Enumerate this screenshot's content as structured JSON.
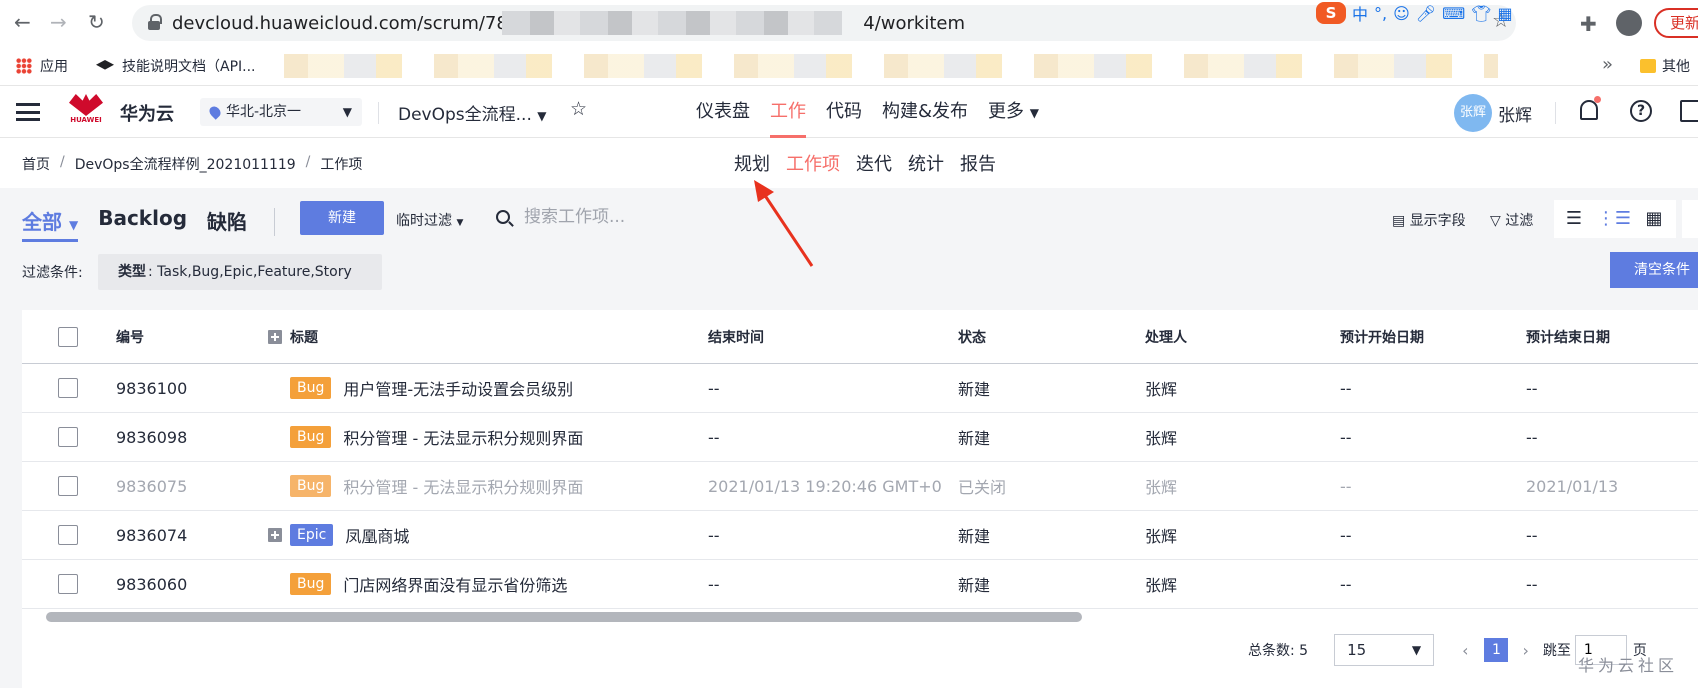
{
  "browser": {
    "url_prefix": "devcloud.huaweicloud.com/scrum/780",
    "url_suffix": "4/workitem",
    "update_label": "更新",
    "bookmarks": [
      {
        "label": "应用"
      },
      {
        "label": "技能说明文档（API..."
      }
    ],
    "other_bookmarks": "其他",
    "ime_label": "中"
  },
  "header": {
    "brand": "华为云",
    "logo_text": "HUAWEI",
    "region": "华北-北京一",
    "project": "DevOps全流程...",
    "nav": [
      {
        "label": "仪表盘",
        "active": false
      },
      {
        "label": "工作",
        "active": true
      },
      {
        "label": "代码",
        "active": false
      },
      {
        "label": "构建&发布",
        "active": false
      },
      {
        "label": "更多",
        "active": false
      }
    ],
    "user_avatar": "张辉",
    "user_name": "张辉"
  },
  "breadcrumb": [
    "首页",
    "DevOps全流程样例_2021011119",
    "工作项"
  ],
  "subnav": [
    {
      "label": "规划",
      "active": false
    },
    {
      "label": "工作项",
      "active": true
    },
    {
      "label": "迭代",
      "active": false
    },
    {
      "label": "统计",
      "active": false
    },
    {
      "label": "报告",
      "active": false
    }
  ],
  "toolbar": {
    "tabs": [
      "全部",
      "Backlog",
      "缺陷"
    ],
    "new_label": "新建",
    "temp_filter": "临时过滤",
    "search_placeholder": "搜索工作项...",
    "fields_label": "显示字段",
    "filter_label": "过滤",
    "filter_condition_label": "过滤条件:",
    "filter_chip_key": "类型",
    "filter_chip_value": ": Task,Bug,Epic,Feature,Story",
    "clear_label": "清空条件"
  },
  "table": {
    "columns": [
      "编号",
      "标题",
      "结束时间",
      "状态",
      "处理人",
      "预计开始日期",
      "预计结束日期"
    ],
    "rows": [
      {
        "id": "9836100",
        "type": "Bug",
        "title": "用户管理-无法手动设置会员级别",
        "end": "--",
        "status": "新建",
        "owner": "张辉",
        "plan_start": "--",
        "plan_end": "--",
        "closed": false,
        "expandable": false
      },
      {
        "id": "9836098",
        "type": "Bug",
        "title": "积分管理 - 无法显示积分规则界面",
        "end": "--",
        "status": "新建",
        "owner": "张辉",
        "plan_start": "--",
        "plan_end": "--",
        "closed": false,
        "expandable": false
      },
      {
        "id": "9836075",
        "type": "Bug",
        "title": "积分管理 - 无法显示积分规则界面",
        "end": "2021/01/13 19:20:46 GMT+0",
        "status": "已关闭",
        "owner": "张辉",
        "plan_start": "--",
        "plan_end": "2021/01/13",
        "closed": true,
        "expandable": false
      },
      {
        "id": "9836074",
        "type": "Epic",
        "title": "凤凰商城",
        "end": "--",
        "status": "新建",
        "owner": "张辉",
        "plan_start": "--",
        "plan_end": "--",
        "closed": false,
        "expandable": true
      },
      {
        "id": "9836060",
        "type": "Bug",
        "title": "门店网络界面没有显示省份筛选",
        "end": "--",
        "status": "新建",
        "owner": "张辉",
        "plan_start": "--",
        "plan_end": "--",
        "closed": false,
        "expandable": false
      }
    ]
  },
  "pagination": {
    "total_label": "总条数: 5",
    "page_size": "15",
    "current_page": "1",
    "jump_label": "跳至",
    "jump_value": "1",
    "unit": "页"
  },
  "watermark": "华为云社区"
}
